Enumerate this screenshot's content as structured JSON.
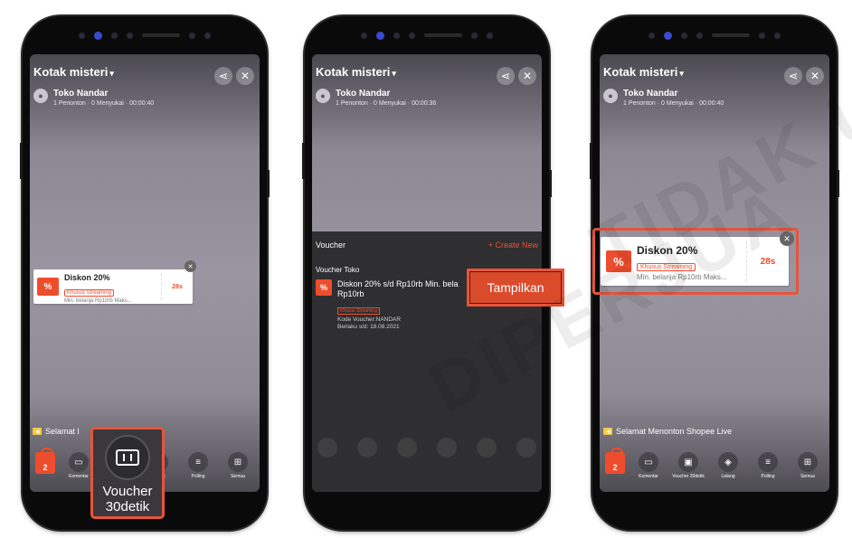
{
  "common": {
    "title": "Kotak misteri",
    "host_name": "Toko Nandar",
    "viewers": "1 Penonton",
    "likes": "0 Menyukai",
    "welcome": "Selamat Menonton Shopee Live",
    "cart_count": "2",
    "tools": {
      "komentar": "Komentar",
      "voucher": "Voucher 30detik",
      "lelang": "Lelang",
      "polling": "Polling",
      "semua": "Semua"
    }
  },
  "phone1": {
    "time": "00:00:40",
    "welcome_visible": "Selamat l",
    "welcome_tail": "ive",
    "voucher": {
      "title": "Diskon 20%",
      "badge": "Khusus Streaming",
      "min": "Min. belanja Rp10rb Maks...",
      "timer": "28s"
    },
    "big_voucher_label_1": "Voucher",
    "big_voucher_label_2": "30detik"
  },
  "phone2": {
    "time": "00:00:36",
    "panel_title": "Voucher",
    "create_new": "+ Create New",
    "section": "Voucher Toko",
    "item": {
      "title_1": "Diskon 20% s/d Rp10rb Min. bela",
      "title_2": "Rp10rb",
      "badge": "Khusus Streaming",
      "code": "Kode Voucher:NANDAR",
      "valid": "Berlaku s/d: 18.08.2021"
    },
    "tampilkan": "Tampilkan"
  },
  "phone3": {
    "time": "00:00:40",
    "voucher": {
      "title": "Diskon 20%",
      "badge": "Khusus Streaming",
      "min": "Min. belanja Rp10rb Maks...",
      "timer": "28s"
    }
  },
  "watermark": {
    "line1": "TIDAK U",
    "line2": "DIPERJUA"
  },
  "colors": {
    "accent": "#ee4d2d",
    "highlight": "#e8543a",
    "panel": "#2f2f31"
  }
}
